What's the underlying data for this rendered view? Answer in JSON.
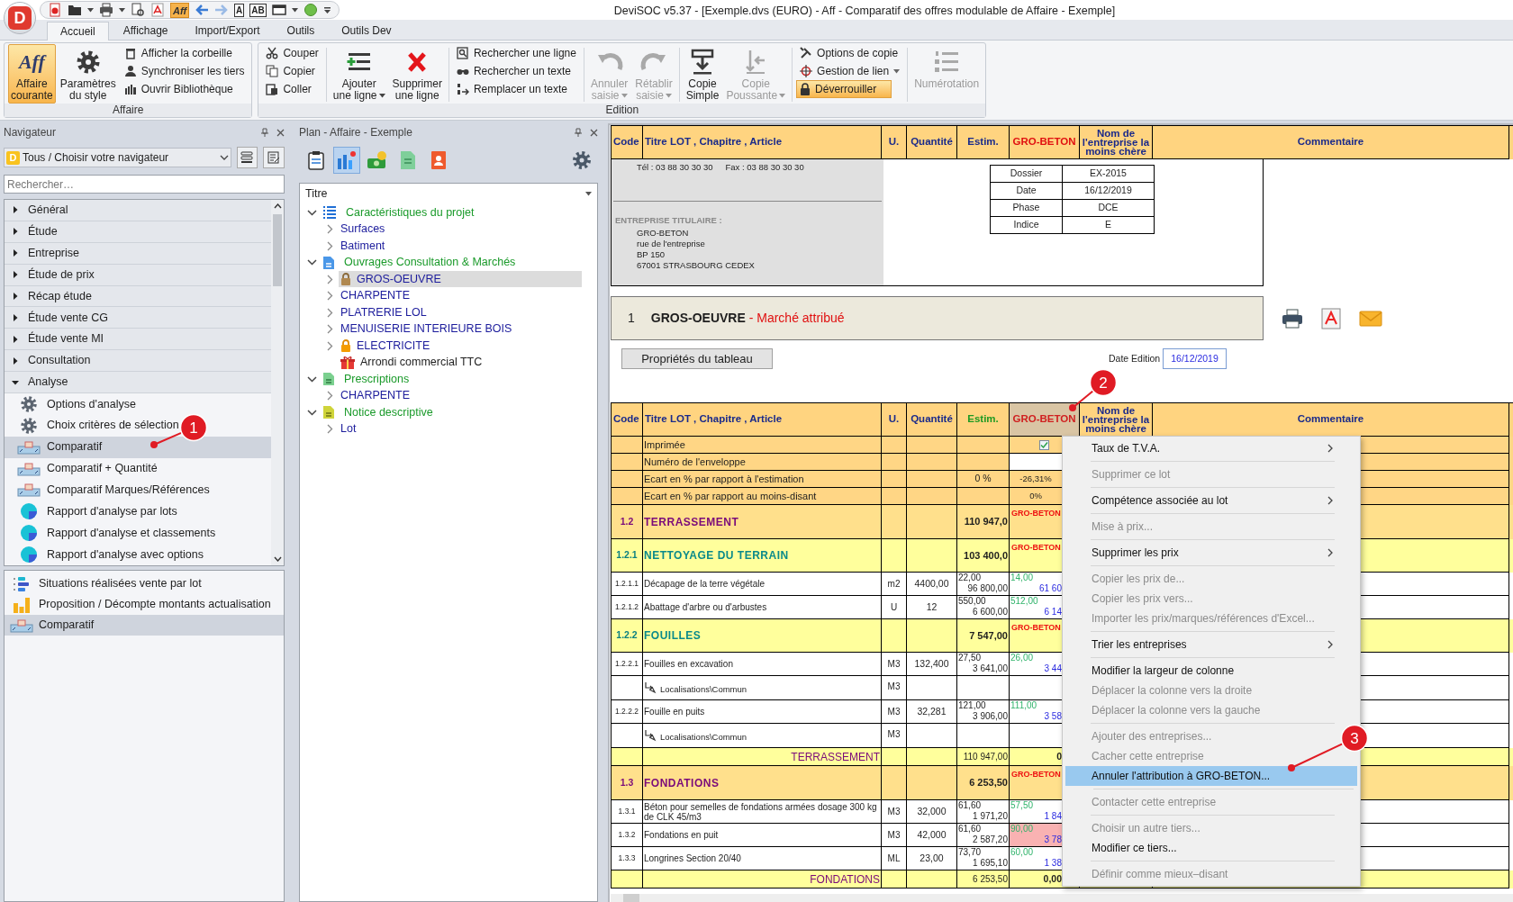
{
  "window": {
    "title": "DeviSOC v5.37 - [Exemple.dvs (EURO) - Aff - Comparatif des offres modulable de Affaire - Exemple]",
    "logo": "D"
  },
  "quick_access": [
    {
      "kind": "pdf-file"
    },
    {
      "kind": "folder"
    },
    {
      "kind": "caret"
    },
    {
      "kind": "print"
    },
    {
      "kind": "caret"
    },
    {
      "kind": "preview"
    },
    {
      "kind": "pdf"
    },
    {
      "kind": "label",
      "label": "Aff"
    },
    {
      "kind": "back"
    },
    {
      "kind": "forward"
    },
    {
      "kind": "framed",
      "label": "A"
    },
    {
      "kind": "framed",
      "label": "AB"
    },
    {
      "kind": "window"
    },
    {
      "kind": "caret"
    },
    {
      "kind": "globe"
    },
    {
      "kind": "customize"
    }
  ],
  "tabs": [
    {
      "label": "Accueil",
      "selected": true
    },
    {
      "label": "Affichage",
      "selected": false
    },
    {
      "label": "Import/Export",
      "selected": false
    },
    {
      "label": "Outils",
      "selected": false
    },
    {
      "label": "Outils Dev",
      "selected": false
    }
  ],
  "ribbon": [
    {
      "label": "Affaire",
      "sections": [
        [
          [
            {
              "label": "Affaire courante",
              "icon_text": "Aff",
              "kind": "affaire",
              "disabled": false,
              "highlighted": true,
              "dropdown": false
            }
          ],
          [
            {
              "label": "Paramètres du style",
              "kind": "style",
              "disabled": false,
              "highlighted": false,
              "dropdown": false
            }
          ],
          [
            {
              "label": "Afficher la corbeille",
              "kind": "trash",
              "disabled": false,
              "highlighted": false,
              "dropdown": false
            },
            {
              "label": "Synchroniser les tiers",
              "kind": "sync",
              "disabled": false,
              "highlighted": false,
              "dropdown": false
            },
            {
              "label": "Ouvrir Bibliothèque",
              "kind": "library",
              "disabled": false,
              "highlighted": false,
              "dropdown": false
            }
          ]
        ]
      ]
    },
    {
      "label": "Edition",
      "sections": [
        [
          [
            {
              "label": "Couper",
              "kind": "cut",
              "disabled": false,
              "highlighted": false,
              "dropdown": false
            },
            {
              "label": "Copier",
              "kind": "copy",
              "disabled": false,
              "highlighted": false,
              "dropdown": false
            },
            {
              "label": "Coller",
              "kind": "paste",
              "disabled": false,
              "highlighted": false,
              "dropdown": false
            }
          ]
        ],
        [
          [
            {
              "label": "Ajouter une ligne",
              "kind": "add",
              "disabled": false,
              "highlighted": false,
              "dropdown": true
            }
          ],
          [
            {
              "label": "Supprimer une ligne",
              "kind": "delete",
              "disabled": false,
              "highlighted": false,
              "dropdown": false
            }
          ]
        ],
        [
          [
            {
              "label": "Rechercher une ligne",
              "kind": "findline",
              "disabled": false,
              "highlighted": false,
              "dropdown": false
            },
            {
              "label": "Rechercher un texte",
              "kind": "findtext",
              "disabled": false,
              "highlighted": false,
              "dropdown": false
            },
            {
              "label": "Remplacer un texte",
              "kind": "replace",
              "disabled": false,
              "highlighted": false,
              "dropdown": false
            }
          ]
        ],
        [
          [
            {
              "label": "Annuler saisie",
              "kind": "undo",
              "disabled": true,
              "highlighted": false,
              "dropdown": true
            }
          ],
          [
            {
              "label": "Rétablir saisie",
              "kind": "redo",
              "disabled": true,
              "highlighted": false,
              "dropdown": true
            }
          ]
        ],
        [
          [
            {
              "label": "Copie Simple",
              "kind": "pastedown",
              "disabled": false,
              "highlighted": false,
              "dropdown": false
            }
          ],
          [
            {
              "label": "Copie Poussante",
              "kind": "push",
              "disabled": true,
              "highlighted": false,
              "dropdown": true
            }
          ]
        ],
        [
          [
            {
              "label": "Options de copie",
              "kind": "options",
              "disabled": false,
              "highlighted": false,
              "dropdown": false
            },
            {
              "label": "Gestion de lien",
              "kind": "link",
              "disabled": false,
              "highlighted": false,
              "dropdown": true
            },
            {
              "label": "Déverrouiller",
              "kind": "unlock",
              "disabled": false,
              "highlighted": true,
              "dropdown": false
            }
          ]
        ],
        [
          [
            {
              "label": "Numérotation",
              "kind": "numbering",
              "disabled": true,
              "highlighted": false,
              "dropdown": false
            }
          ]
        ]
      ]
    }
  ],
  "navigator": {
    "title": "Navigateur",
    "selector": {
      "badge": "D",
      "value": "Tous / Choisir votre navigateur"
    },
    "search": {
      "placeholder": "Rechercher…"
    },
    "categories": [
      {
        "label": "Général",
        "expanded": false
      },
      {
        "label": "Étude",
        "expanded": false
      },
      {
        "label": "Entreprise",
        "expanded": false
      },
      {
        "label": "Étude de prix",
        "expanded": false
      },
      {
        "label": "Récap étude",
        "expanded": false
      },
      {
        "label": "Étude vente CG",
        "expanded": false
      },
      {
        "label": "Étude vente MI",
        "expanded": false
      },
      {
        "label": "Consultation",
        "expanded": false
      },
      {
        "label": "Analyse",
        "expanded": true,
        "children": [
          {
            "label": "Options d'analyse",
            "kind": "settings",
            "selected": false
          },
          {
            "label": "Choix critères de sélection",
            "kind": "settings",
            "selected": false
          },
          {
            "label": "Comparatif",
            "kind": "comparison",
            "selected": true
          },
          {
            "label": "Comparatif + Quantité",
            "kind": "comparison",
            "selected": false
          },
          {
            "label": "Comparatif Marques/Références",
            "kind": "comparison",
            "selected": false
          },
          {
            "label": "Rapport d'analyse par lots",
            "kind": "report",
            "selected": false
          },
          {
            "label": "Rapport d'analyse et classements",
            "kind": "report",
            "selected": false
          },
          {
            "label": "Rapport d'analyse avec options",
            "kind": "report",
            "selected": false
          }
        ]
      }
    ],
    "shortcuts": [
      {
        "label": "Situations réalisées vente par lot",
        "kind": "progress",
        "selected": false
      },
      {
        "label": "Proposition / Décompte montants actualisation",
        "kind": "amounts",
        "selected": false
      },
      {
        "label": "Comparatif",
        "kind": "comparison",
        "selected": true
      }
    ]
  },
  "plan": {
    "title": "Plan - Affaire - Exemple",
    "tools": [
      {
        "kind": "clipboard",
        "selected": false
      },
      {
        "kind": "planning",
        "selected": true
      },
      {
        "kind": "money",
        "selected": false
      },
      {
        "kind": "sheet",
        "selected": false
      },
      {
        "kind": "contact",
        "selected": false
      }
    ],
    "tree_header": "Titre",
    "tree": [
      {
        "label": "Caractéristiques du projet",
        "kind": "list",
        "expanded": true,
        "children": [
          {
            "label": "Surfaces",
            "kind": "lot",
            "expanded": false,
            "locked": false,
            "selected": false
          },
          {
            "label": "Batiment",
            "kind": "lot",
            "expanded": false,
            "locked": false,
            "selected": false
          }
        ]
      },
      {
        "label": "Ouvrages Consultation & Marchés",
        "kind": "works",
        "expanded": true,
        "children": [
          {
            "label": "GROS-OEUVRE",
            "kind": "lot",
            "expanded": false,
            "locked": true,
            "selected": true
          },
          {
            "label": "CHARPENTE",
            "kind": "lot",
            "expanded": false,
            "locked": false,
            "selected": false
          },
          {
            "label": "PLATRERIE LOL",
            "kind": "lot",
            "expanded": false,
            "locked": false,
            "selected": false
          },
          {
            "label": "MENUISERIE INTERIEURE BOIS",
            "kind": "lot",
            "expanded": false,
            "locked": false,
            "selected": false
          },
          {
            "label": "ELECTRICITE",
            "kind": "lot",
            "expanded": false,
            "locked": true,
            "selected": false
          },
          {
            "label": "Arrondi commercial TTC",
            "kind": "rounding"
          }
        ]
      },
      {
        "label": "Prescriptions",
        "kind": "prescriptions",
        "expanded": true,
        "children": [
          {
            "label": "CHARPENTE",
            "kind": "lot",
            "expanded": false,
            "locked": false,
            "selected": false
          }
        ]
      },
      {
        "label": "Notice descriptive",
        "kind": "notice",
        "expanded": true,
        "children": [
          {
            "label": "Lot",
            "kind": "lot",
            "expanded": false,
            "locked": false,
            "selected": false
          }
        ]
      }
    ]
  },
  "document": {
    "top_header": {
      "estimate_highlighted": false,
      "company_selected": false,
      "columns": [
        {
          "label": "Code",
          "kind": "text"
        },
        {
          "label": "Titre LOT , Chapitre , Article",
          "kind": "text"
        },
        {
          "label": "U.",
          "kind": "text"
        },
        {
          "label": "Quantité",
          "kind": "text"
        },
        {
          "label": "Estim.",
          "kind": "estimate"
        },
        {
          "label": "GRO-BETON",
          "kind": "company"
        },
        {
          "label": "Nom de l'entreprise la moins chère",
          "kind": "text"
        },
        {
          "label": "Commentaire",
          "kind": "text"
        }
      ]
    },
    "info": {
      "phone": "Tél : 03 88 30 30 30",
      "fax": "Fax : 03 88 30 30 30",
      "holder_label": "ENTREPRISE TITULAIRE :",
      "holder_lines": [
        "GRO-BETON",
        "rue de l'entreprise",
        "BP 150",
        "67001 STRASBOURG CEDEX"
      ]
    },
    "file_table": [
      {
        "label": "Dossier",
        "value": "EX-2015"
      },
      {
        "label": "Date",
        "value": "16/12/2019"
      },
      {
        "label": "Phase",
        "value": "DCE"
      },
      {
        "label": "Indice",
        "value": "E"
      }
    ],
    "lot": {
      "number": "1",
      "title": "GROS-OEUVRE",
      "status": "- Marché attribué"
    },
    "properties_button": "Propriétés du tableau",
    "date_label": "Date Edition",
    "date_value": "16/12/2019",
    "table_header": {
      "estimate_highlighted": true,
      "company_selected": true,
      "columns": [
        {
          "label": "Code",
          "kind": "text"
        },
        {
          "label": "Titre LOT , Chapitre , Article",
          "kind": "text"
        },
        {
          "label": "U.",
          "kind": "text"
        },
        {
          "label": "Quantité",
          "kind": "text"
        },
        {
          "label": "Estim.",
          "kind": "estimate"
        },
        {
          "label": "GRO-BETON",
          "kind": "company"
        },
        {
          "label": "Nom de l'entreprise la moins chère",
          "kind": "text"
        },
        {
          "label": "Commentaire",
          "kind": "text"
        }
      ]
    },
    "rows": [
      {
        "kind": "meta",
        "title": "Imprimée",
        "company": {
          "kind": "checkbox",
          "checked": true
        }
      },
      {
        "kind": "meta",
        "title": "Numéro de l'enveloppe",
        "company": {
          "kind": "field"
        }
      },
      {
        "kind": "meta",
        "title": "Ecart en % par rapport à l'estimation",
        "estimate": "0 %",
        "company": {
          "kind": "text",
          "text": "-26,31%"
        }
      },
      {
        "kind": "meta",
        "title": "Ecart en % par rapport au moins-disant",
        "company": {
          "kind": "text",
          "text": "0%"
        }
      },
      {
        "kind": "lot",
        "code": "1.2",
        "title": "TERRASSEMENT",
        "estimate": "110 947,0",
        "company": {
          "kind": "name",
          "text": "GRO-BETON"
        }
      },
      {
        "kind": "chapter",
        "code": "1.2.1",
        "title": "NETTOYAGE DU TERRAIN",
        "estimate": "103 400,0",
        "company": {
          "kind": "name",
          "text": "GRO-BETON"
        }
      },
      {
        "kind": "item",
        "code": "1.2.1.1",
        "title": "Décapage de la terre végétale",
        "unit": "m2",
        "quantity": "4400,00",
        "price": "22,00",
        "total": "96 800,00",
        "company": {
          "kind": "offer",
          "price": "14,00",
          "total": "61 60",
          "flagged": false
        }
      },
      {
        "kind": "item",
        "code": "1.2.1.2",
        "title": "Abattage d'arbre ou d'arbustes",
        "unit": "U",
        "quantity": "12",
        "price": "550,00",
        "total": "6 600,00",
        "company": {
          "kind": "offer",
          "price": "512,00",
          "total": "6 14",
          "flagged": false
        }
      },
      {
        "kind": "chapter",
        "code": "1.2.2",
        "title": "FOUILLES",
        "estimate": "7 547,00",
        "company": {
          "kind": "name",
          "text": "GRO-BETON"
        }
      },
      {
        "kind": "item",
        "code": "1.2.2.1",
        "title": "Fouilles en excavation",
        "unit": "M3",
        "quantity": "132,400",
        "price": "27,50",
        "total": "3 641,00",
        "company": {
          "kind": "offer",
          "price": "26,00",
          "total": "3 44",
          "flagged": false
        }
      },
      {
        "kind": "location",
        "title": "Localisations\\Commun",
        "unit": "M3"
      },
      {
        "kind": "item",
        "code": "1.2.2.2",
        "title": "Fouille en puits",
        "unit": "M3",
        "quantity": "32,281",
        "price": "121,00",
        "total": "3 906,00",
        "company": {
          "kind": "offer",
          "price": "111,00",
          "total": "3 58",
          "flagged": false
        }
      },
      {
        "kind": "location",
        "title": "Localisations\\Commun",
        "unit": "M3"
      },
      {
        "kind": "total",
        "title": "TERRASSEMENT",
        "estimate": "110 947,00",
        "company": {
          "kind": "total",
          "text": "0"
        }
      },
      {
        "kind": "lot",
        "code": "1.3",
        "title": "FONDATIONS",
        "estimate": "6 253,50",
        "company": {
          "kind": "name",
          "text": "GRO-BETON"
        }
      },
      {
        "kind": "item",
        "code": "1.3.1",
        "title": "Béton pour semelles de fondations armées dosage 300 kg de CLK 45/m3",
        "unit": "M3",
        "quantity": "32,000",
        "price": "61,60",
        "total": "1 971,20",
        "company": {
          "kind": "offer",
          "price": "57,50",
          "total": "1 84",
          "flagged": false
        }
      },
      {
        "kind": "item",
        "code": "1.3.2",
        "title": "Fondations en puit",
        "unit": "M3",
        "quantity": "42,000",
        "price": "61,60",
        "total": "2 587,20",
        "company": {
          "kind": "offer",
          "price": "90,00",
          "total": "3 78",
          "flagged": true
        }
      },
      {
        "kind": "item",
        "code": "1.3.3",
        "title": "Longrines Section 20/40",
        "unit": "ML",
        "quantity": "23,00",
        "price": "73,70",
        "total": "1 695,10",
        "company": {
          "kind": "offer",
          "price": "60,00",
          "total": "1 38",
          "flagged": false
        }
      },
      {
        "kind": "total",
        "title": "FONDATIONS",
        "estimate": "6 253,50",
        "company": {
          "kind": "total",
          "text": "0,00"
        }
      }
    ]
  },
  "context_menu": [
    {
      "label": "Taux de T.V.A.",
      "disabled": false,
      "submenu": true,
      "selected": false,
      "separator_after": true
    },
    {
      "label": "Supprimer ce lot",
      "disabled": true,
      "submenu": false,
      "selected": false,
      "separator_after": true
    },
    {
      "label": "Compétence associée au lot",
      "disabled": false,
      "submenu": true,
      "selected": false,
      "separator_after": true
    },
    {
      "label": "Mise à prix...",
      "disabled": true,
      "submenu": false,
      "selected": false,
      "separator_after": true
    },
    {
      "label": "Supprimer les prix",
      "disabled": false,
      "submenu": true,
      "selected": false,
      "separator_after": true
    },
    {
      "label": "Copier les prix de...",
      "disabled": true,
      "submenu": false,
      "selected": false,
      "separator_after": false
    },
    {
      "label": "Copier les prix vers...",
      "disabled": true,
      "submenu": false,
      "selected": false,
      "separator_after": false
    },
    {
      "label": "Importer les prix/marques/références d'Excel...",
      "disabled": true,
      "submenu": false,
      "selected": false,
      "separator_after": true
    },
    {
      "label": "Trier les entreprises",
      "disabled": false,
      "submenu": true,
      "selected": false,
      "separator_after": true
    },
    {
      "label": "Modifier la largeur de colonne",
      "disabled": false,
      "submenu": false,
      "selected": false,
      "separator_after": false
    },
    {
      "label": "Déplacer la colonne vers la droite",
      "disabled": true,
      "submenu": false,
      "selected": false,
      "separator_after": false
    },
    {
      "label": "Déplacer la colonne vers la gauche",
      "disabled": true,
      "submenu": false,
      "selected": false,
      "separator_after": true
    },
    {
      "label": "Ajouter des entreprises...",
      "disabled": true,
      "submenu": false,
      "selected": false,
      "separator_after": false
    },
    {
      "label": "Cacher cette entreprise",
      "disabled": true,
      "submenu": false,
      "selected": false,
      "separator_after": false
    },
    {
      "label": "Annuler l'attribution à GRO-BETON...",
      "disabled": false,
      "submenu": false,
      "selected": true,
      "separator_after": true
    },
    {
      "label": "Contacter cette entreprise",
      "disabled": true,
      "submenu": false,
      "selected": false,
      "separator_after": true
    },
    {
      "label": "Choisir un autre tiers...",
      "disabled": true,
      "submenu": false,
      "selected": false,
      "separator_after": false
    },
    {
      "label": "Modifier ce tiers...",
      "disabled": false,
      "submenu": false,
      "selected": false,
      "separator_after": true
    },
    {
      "label": "Définir comme mieux–disant",
      "disabled": true,
      "submenu": false,
      "selected": false,
      "separator_after": false
    }
  ],
  "callouts": [
    "1",
    "2",
    "3"
  ]
}
